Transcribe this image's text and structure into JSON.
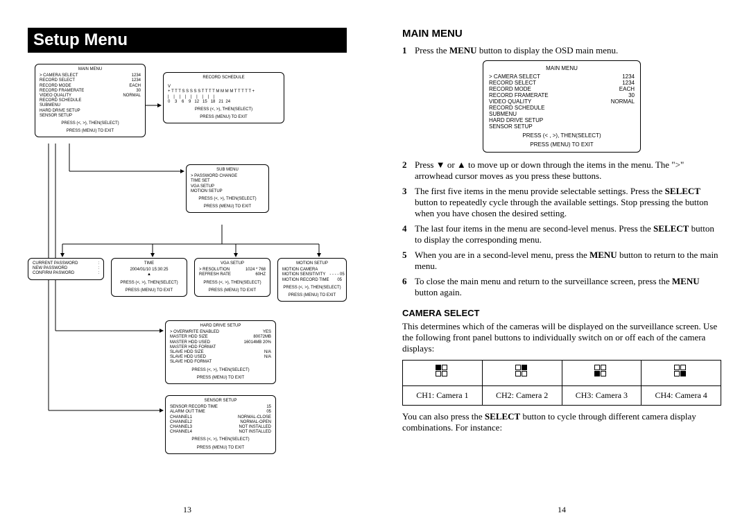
{
  "left": {
    "banner": "Setup Menu",
    "pageNum": "13",
    "mainMenu": {
      "title": "MAIN MENU",
      "items": [
        [
          "> CAMERA SELECT",
          "1234"
        ],
        [
          "RECORD SELECT",
          "1234"
        ],
        [
          "RECORD MODE",
          "EACH"
        ],
        [
          "RECORD FRAMERATE",
          "30"
        ],
        [
          "VIDEO QUALITY",
          "NORMAL"
        ],
        [
          "RECORD SCHEDULE",
          ""
        ],
        [
          "SUBMENU",
          ""
        ],
        [
          "HARD DRIVE SETUP",
          ""
        ],
        [
          "SENSOR SETUP",
          ""
        ]
      ],
      "foot1": "PRESS (<, >), THEN(SELECT)",
      "foot2": "PRESS (MENU) TO EXIT"
    },
    "recordSchedule": {
      "title": "RECORD SCHEDULE",
      "row1": "V",
      "row2": "+ T T T S S S S S T T T T M M M M T T T T T +",
      "row3": "|    |    |    |    |    |    |    |    |",
      "row4": "0    3    6    9   12   15   18   21  24",
      "foot1": "PRESS (<, >), THEN(SELECT)",
      "foot2": "PRESS (MENU) TO EXIT"
    },
    "subMenu": {
      "title": "SUB MENU",
      "items": [
        "> PASSWORD CHANGE",
        "TIME SET",
        "VGA SETUP",
        "MOTION SETUP"
      ],
      "foot1": "PRESS (<, >), THEN(SELECT)",
      "foot2": "PRESS (MENU) TO EXIT"
    },
    "password": {
      "items": [
        [
          "CURRENT  PASSWORD",
          ":"
        ],
        [
          "NEW    PASSWORD",
          ":"
        ],
        [
          "CONFIRM   PASWORD",
          ":"
        ]
      ]
    },
    "time": {
      "title": "TIME",
      "line": "2004/01/10  15:30:25",
      "foot1": "PRESS (<, >), THEN(SELECT)",
      "foot2": "PRESS (MENU) TO EXIT"
    },
    "vga": {
      "title": "VGA SETUP",
      "items": [
        [
          "> RESOLUTION",
          "1024 * 768"
        ],
        [
          "REFRESH RATE",
          "60HZ"
        ]
      ],
      "foot1": "PRESS (<, >), THEN(SELECT)",
      "foot2": "PRESS (MENU) TO EXIT"
    },
    "motion": {
      "title": "MOTION SETUP",
      "items": [
        [
          "MOTION CAMERA",
          ""
        ],
        [
          "MOTION SENSITIVITY",
          "- - - - 05"
        ],
        [
          "MOTION RECORD TIME",
          "05"
        ]
      ],
      "foot1": "PRESS (<, >), THEN(SELECT)",
      "foot2": "PRESS (MENU) TO EXIT"
    },
    "hdd": {
      "title": "HARD DRIVE SETUP",
      "items": [
        [
          "> OVERWRITE ENABLED",
          "YES"
        ],
        [
          "MASTER HDD SIZE",
          "80072MB"
        ],
        [
          "MASTER HDD USED",
          "16014MB  20%"
        ],
        [
          "MASTER HDD FORMAT",
          ""
        ],
        [
          "SLAVE HDD SIZE",
          "N/A"
        ],
        [
          "SLAVE HDD USED",
          "N/A"
        ],
        [
          "SLAVE HDD FORMAT",
          ""
        ]
      ],
      "foot1": "PRESS (<, >), THEN(SELECT)",
      "foot2": "PRESS (MENU) TO EXIT"
    },
    "sensor": {
      "title": "SENSOR SETUP",
      "items": [
        [
          "SENSOR RECORD TIME",
          "15"
        ],
        [
          "ALARM OUT TIME",
          "05"
        ],
        [
          "CHANNEL1",
          "NORMAL-CLOSE"
        ],
        [
          "CHANNEL2",
          "NORMAL-OPEN"
        ],
        [
          "CHANNEL3",
          "NOT INSTALLED"
        ],
        [
          "CHANNEL4",
          "NOT INSTALLED"
        ]
      ],
      "foot1": "PRESS (<, >), THEN(SELECT)",
      "foot2": "PRESS (MENU) TO EXIT"
    }
  },
  "right": {
    "pageNum": "14",
    "hMain": "MAIN MENU",
    "menuBox": {
      "title": "MAIN MENU",
      "items": [
        [
          "> CAMERA SELECT",
          "1234"
        ],
        [
          "RECORD SELECT",
          "1234"
        ],
        [
          "RECORD MODE",
          "EACH"
        ],
        [
          "RECORD FRAMERATE",
          "30"
        ],
        [
          "VIDEO QUALITY",
          "NORMAL"
        ],
        [
          "RECORD SCHEDULE",
          ""
        ],
        [
          "SUBMENU",
          ""
        ],
        [
          "HARD DRIVE SETUP",
          ""
        ],
        [
          "SENSOR SETUP",
          ""
        ]
      ],
      "foot1": "PRESS (< , >), THEN(SELECT)",
      "foot2": "PRESS (MENU) TO EXIT"
    },
    "steps": {
      "s1a": "Press the ",
      "s1b": "MENU",
      "s1c": " button to display the OSD main menu.",
      "s2": "Press ▼ or ▲ to move up or down through the items in the menu. The \">\" arrowhead cursor moves as you press these buttons.",
      "s3a": "The first five items in the menu provide selectable settings. Press the ",
      "s3b": "SELECT",
      "s3c": " button to repeatedly cycle through the available settings. Stop pressing the button when you have chosen the desired setting.",
      "s4a": "The last four items in the menu are second-level menus. Press the ",
      "s4b": "SELECT",
      "s4c": " button to display the corresponding menu.",
      "s5a": "When you are in a second-level menu, press the ",
      "s5b": "MENU",
      "s5c": " button to return to the main menu.",
      "s6a": "To close the main menu and return to the surveillance screen, press the ",
      "s6b": "MENU",
      "s6c": " button again."
    },
    "hCamera": "CAMERA SELECT",
    "cameraIntro": "This determines which of the cameras will be displayed on the surveillance screen. Use the following front panel buttons to individually switch on or off each of the camera displays:",
    "ch": [
      "CH1: Camera 1",
      "CH2: Camera 2",
      "CH3: Camera 3",
      "CH4: Camera 4"
    ],
    "afterA": "You can also press the ",
    "afterB": "SELECT",
    "afterC": " button to cycle through different camera display combinations. For instance:"
  }
}
